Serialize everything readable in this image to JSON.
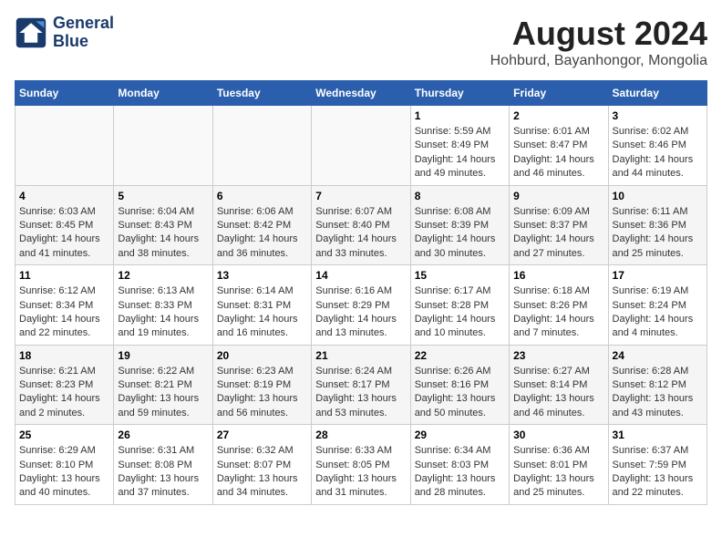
{
  "header": {
    "logo_line1": "General",
    "logo_line2": "Blue",
    "month_year": "August 2024",
    "location": "Hohburd, Bayanhongor, Mongolia"
  },
  "weekdays": [
    "Sunday",
    "Monday",
    "Tuesday",
    "Wednesday",
    "Thursday",
    "Friday",
    "Saturday"
  ],
  "weeks": [
    [
      {
        "day": "",
        "info": ""
      },
      {
        "day": "",
        "info": ""
      },
      {
        "day": "",
        "info": ""
      },
      {
        "day": "",
        "info": ""
      },
      {
        "day": "1",
        "info": "Sunrise: 5:59 AM\nSunset: 8:49 PM\nDaylight: 14 hours\nand 49 minutes."
      },
      {
        "day": "2",
        "info": "Sunrise: 6:01 AM\nSunset: 8:47 PM\nDaylight: 14 hours\nand 46 minutes."
      },
      {
        "day": "3",
        "info": "Sunrise: 6:02 AM\nSunset: 8:46 PM\nDaylight: 14 hours\nand 44 minutes."
      }
    ],
    [
      {
        "day": "4",
        "info": "Sunrise: 6:03 AM\nSunset: 8:45 PM\nDaylight: 14 hours\nand 41 minutes."
      },
      {
        "day": "5",
        "info": "Sunrise: 6:04 AM\nSunset: 8:43 PM\nDaylight: 14 hours\nand 38 minutes."
      },
      {
        "day": "6",
        "info": "Sunrise: 6:06 AM\nSunset: 8:42 PM\nDaylight: 14 hours\nand 36 minutes."
      },
      {
        "day": "7",
        "info": "Sunrise: 6:07 AM\nSunset: 8:40 PM\nDaylight: 14 hours\nand 33 minutes."
      },
      {
        "day": "8",
        "info": "Sunrise: 6:08 AM\nSunset: 8:39 PM\nDaylight: 14 hours\nand 30 minutes."
      },
      {
        "day": "9",
        "info": "Sunrise: 6:09 AM\nSunset: 8:37 PM\nDaylight: 14 hours\nand 27 minutes."
      },
      {
        "day": "10",
        "info": "Sunrise: 6:11 AM\nSunset: 8:36 PM\nDaylight: 14 hours\nand 25 minutes."
      }
    ],
    [
      {
        "day": "11",
        "info": "Sunrise: 6:12 AM\nSunset: 8:34 PM\nDaylight: 14 hours\nand 22 minutes."
      },
      {
        "day": "12",
        "info": "Sunrise: 6:13 AM\nSunset: 8:33 PM\nDaylight: 14 hours\nand 19 minutes."
      },
      {
        "day": "13",
        "info": "Sunrise: 6:14 AM\nSunset: 8:31 PM\nDaylight: 14 hours\nand 16 minutes."
      },
      {
        "day": "14",
        "info": "Sunrise: 6:16 AM\nSunset: 8:29 PM\nDaylight: 14 hours\nand 13 minutes."
      },
      {
        "day": "15",
        "info": "Sunrise: 6:17 AM\nSunset: 8:28 PM\nDaylight: 14 hours\nand 10 minutes."
      },
      {
        "day": "16",
        "info": "Sunrise: 6:18 AM\nSunset: 8:26 PM\nDaylight: 14 hours\nand 7 minutes."
      },
      {
        "day": "17",
        "info": "Sunrise: 6:19 AM\nSunset: 8:24 PM\nDaylight: 14 hours\nand 4 minutes."
      }
    ],
    [
      {
        "day": "18",
        "info": "Sunrise: 6:21 AM\nSunset: 8:23 PM\nDaylight: 14 hours\nand 2 minutes."
      },
      {
        "day": "19",
        "info": "Sunrise: 6:22 AM\nSunset: 8:21 PM\nDaylight: 13 hours\nand 59 minutes."
      },
      {
        "day": "20",
        "info": "Sunrise: 6:23 AM\nSunset: 8:19 PM\nDaylight: 13 hours\nand 56 minutes."
      },
      {
        "day": "21",
        "info": "Sunrise: 6:24 AM\nSunset: 8:17 PM\nDaylight: 13 hours\nand 53 minutes."
      },
      {
        "day": "22",
        "info": "Sunrise: 6:26 AM\nSunset: 8:16 PM\nDaylight: 13 hours\nand 50 minutes."
      },
      {
        "day": "23",
        "info": "Sunrise: 6:27 AM\nSunset: 8:14 PM\nDaylight: 13 hours\nand 46 minutes."
      },
      {
        "day": "24",
        "info": "Sunrise: 6:28 AM\nSunset: 8:12 PM\nDaylight: 13 hours\nand 43 minutes."
      }
    ],
    [
      {
        "day": "25",
        "info": "Sunrise: 6:29 AM\nSunset: 8:10 PM\nDaylight: 13 hours\nand 40 minutes."
      },
      {
        "day": "26",
        "info": "Sunrise: 6:31 AM\nSunset: 8:08 PM\nDaylight: 13 hours\nand 37 minutes."
      },
      {
        "day": "27",
        "info": "Sunrise: 6:32 AM\nSunset: 8:07 PM\nDaylight: 13 hours\nand 34 minutes."
      },
      {
        "day": "28",
        "info": "Sunrise: 6:33 AM\nSunset: 8:05 PM\nDaylight: 13 hours\nand 31 minutes."
      },
      {
        "day": "29",
        "info": "Sunrise: 6:34 AM\nSunset: 8:03 PM\nDaylight: 13 hours\nand 28 minutes."
      },
      {
        "day": "30",
        "info": "Sunrise: 6:36 AM\nSunset: 8:01 PM\nDaylight: 13 hours\nand 25 minutes."
      },
      {
        "day": "31",
        "info": "Sunrise: 6:37 AM\nSunset: 7:59 PM\nDaylight: 13 hours\nand 22 minutes."
      }
    ]
  ]
}
